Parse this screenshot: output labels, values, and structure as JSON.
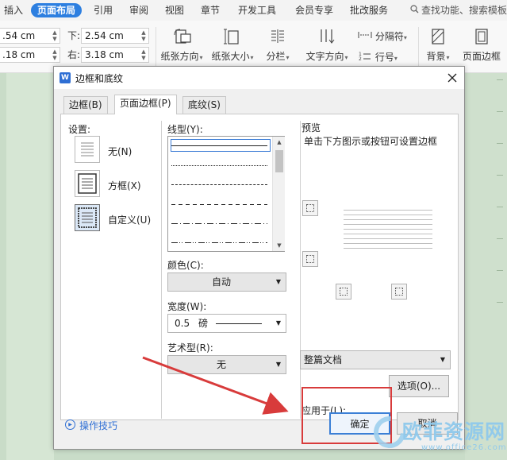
{
  "menubar": {
    "items": [
      "插入",
      "页面布局",
      "引用",
      "审阅",
      "视图",
      "章节",
      "开发工具",
      "会员专享",
      "批改服务"
    ],
    "active_index": 1,
    "search_placeholder": "查找功能、搜索模板"
  },
  "toolbar": {
    "margins": [
      {
        "label": "",
        "value": ".54 cm"
      },
      {
        "label": "下:",
        "value": "2.54 cm"
      },
      {
        "label": "",
        "value": ".18 cm"
      },
      {
        "label": "右:",
        "value": "3.18 cm"
      }
    ],
    "buttons": [
      {
        "label": "纸张方向",
        "icon": "page-orientation-icon"
      },
      {
        "label": "纸张大小",
        "icon": "page-size-icon"
      },
      {
        "label": "分栏",
        "icon": "columns-icon"
      },
      {
        "label": "文字方向",
        "icon": "text-direction-icon"
      },
      {
        "label": "背景",
        "icon": "background-icon"
      },
      {
        "label": "页面边框",
        "icon": "page-border-icon"
      }
    ],
    "separator_label": "分隔符",
    "line_number_label": "行号"
  },
  "dialog": {
    "title": "边框和底纹",
    "app_icon_letter": "W",
    "tabs": [
      "边框(B)",
      "页面边框(P)",
      "底纹(S)"
    ],
    "active_tab": 1,
    "setting_label": "设置:",
    "settings": [
      {
        "label": "无(N)",
        "icon": "no-border-icon"
      },
      {
        "label": "方框(X)",
        "icon": "box-border-icon"
      },
      {
        "label": "自定义(U)",
        "icon": "custom-border-icon"
      }
    ],
    "selected_setting": 2,
    "linestyle_label": "线型(Y):",
    "linestyles": [
      "solid",
      "dotted",
      "dashed-short",
      "dashed",
      "dash-dot",
      "dash-dot-dot"
    ],
    "color_label": "颜色(C):",
    "color_value": "自动",
    "width_label": "宽度(W):",
    "width_value": "0.5",
    "width_unit": "磅",
    "art_label": "艺术型(R):",
    "art_value": "无",
    "preview_label": "预览",
    "preview_hint": "单击下方图示或按钮可设置边框",
    "apply_label": "应用于(L):",
    "apply_value": "整篇文档",
    "options_button": "选项(O)...",
    "tips_link": "操作技巧",
    "ok_button": "确定",
    "cancel_button": "取消"
  },
  "watermark": {
    "text": "欧菲资源网",
    "url": "www.office26.com"
  },
  "colors": {
    "accent": "#2d7fe0",
    "annotation": "#d83b3b",
    "document_bg": "#c9dcc8"
  }
}
